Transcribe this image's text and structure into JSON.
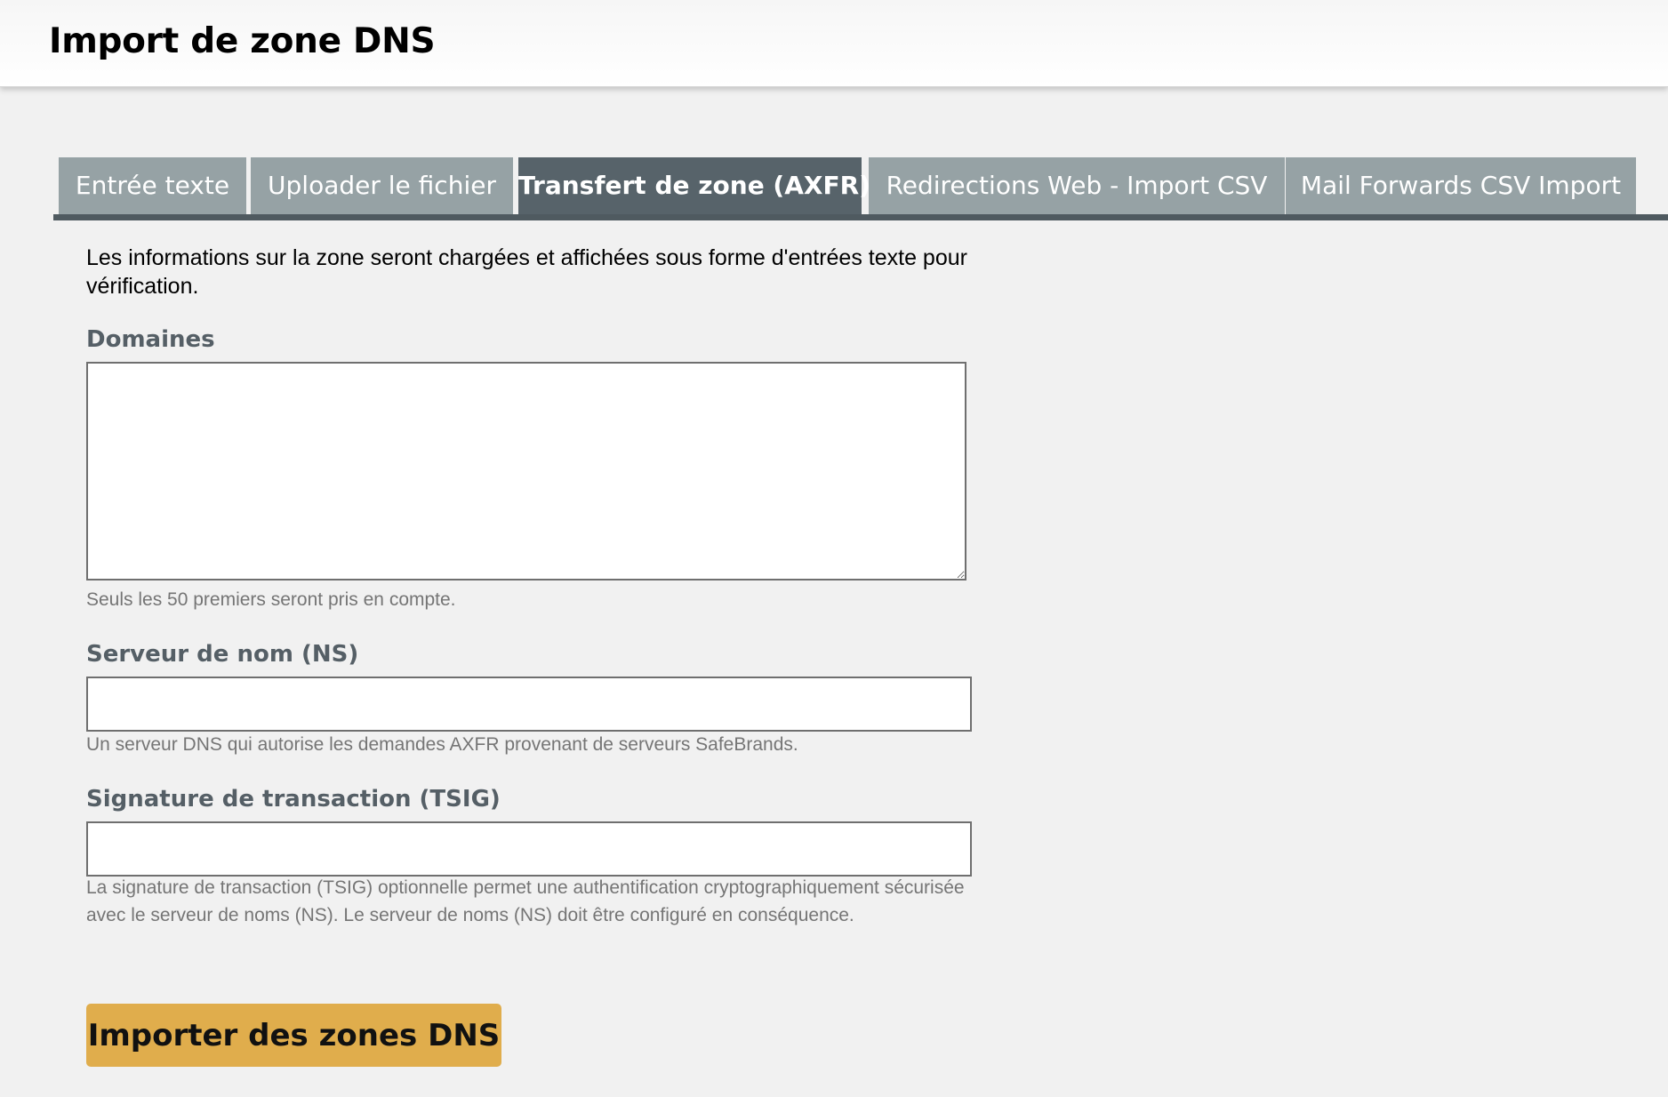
{
  "header": {
    "title": "Import de zone DNS"
  },
  "tabs": [
    {
      "label": "Entrée texte",
      "active": false
    },
    {
      "label": "Uploader le fichier",
      "active": false
    },
    {
      "label": "Transfert de zone (AXFR)",
      "active": true
    },
    {
      "label": "Redirections Web - Import CSV",
      "active": false
    },
    {
      "label": "Mail Forwards CSV Import",
      "active": false
    }
  ],
  "form": {
    "intro": "Les informations sur la zone seront chargées et affichées sous forme d'entrées texte pour vérification.",
    "domains": {
      "label": "Domaines",
      "value": "",
      "help": "Seuls les 50 premiers seront pris en compte."
    },
    "nameserver": {
      "label": "Serveur de nom (NS)",
      "value": "",
      "help": "Un serveur DNS qui autorise les demandes AXFR provenant de serveurs SafeBrands."
    },
    "tsig": {
      "label": "Signature de transaction (TSIG)",
      "value": "",
      "help": "La signature de transaction (TSIG) optionnelle permet une authentification cryptographiquement sécurisée avec le serveur de noms (NS). Le serveur de noms (NS) doit être configuré en conséquence."
    },
    "submit_label": "Importer des zones DNS"
  },
  "colors": {
    "tab_inactive": "#96a2a5",
    "tab_active": "#57636a",
    "button": "#e0ad4c",
    "label": "#555f66"
  }
}
